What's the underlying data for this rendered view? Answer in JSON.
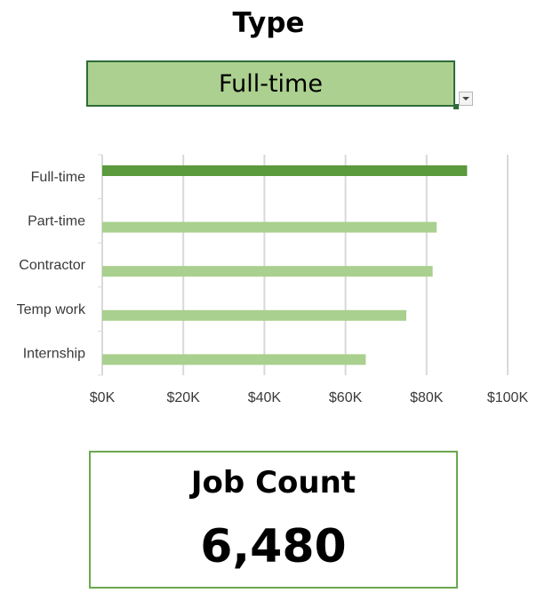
{
  "slicer": {
    "title": "Type",
    "selected": "Full-time"
  },
  "colors": {
    "selected_bar": "#5b9a3c",
    "bar": "#a9d08e",
    "dropdown_fill": "#acd08f",
    "kpi_border": "#6aa84f"
  },
  "chart_data": {
    "type": "bar",
    "orientation": "horizontal",
    "categories": [
      "Full-time",
      "Part-time",
      "Contractor",
      "Temp work",
      "Internship"
    ],
    "values": [
      90000,
      82500,
      81500,
      75000,
      65000
    ],
    "highlighted_category": "Full-time",
    "xlim": [
      0,
      100000
    ],
    "xticks": [
      0,
      20000,
      40000,
      60000,
      80000,
      100000
    ],
    "xtick_labels": [
      "$0K",
      "$20K",
      "$40K",
      "$60K",
      "$80K",
      "$100K"
    ],
    "title": "",
    "xlabel": "",
    "ylabel": "",
    "grid": "vertical"
  },
  "kpi": {
    "label": "Job Count",
    "value": "6,480"
  }
}
